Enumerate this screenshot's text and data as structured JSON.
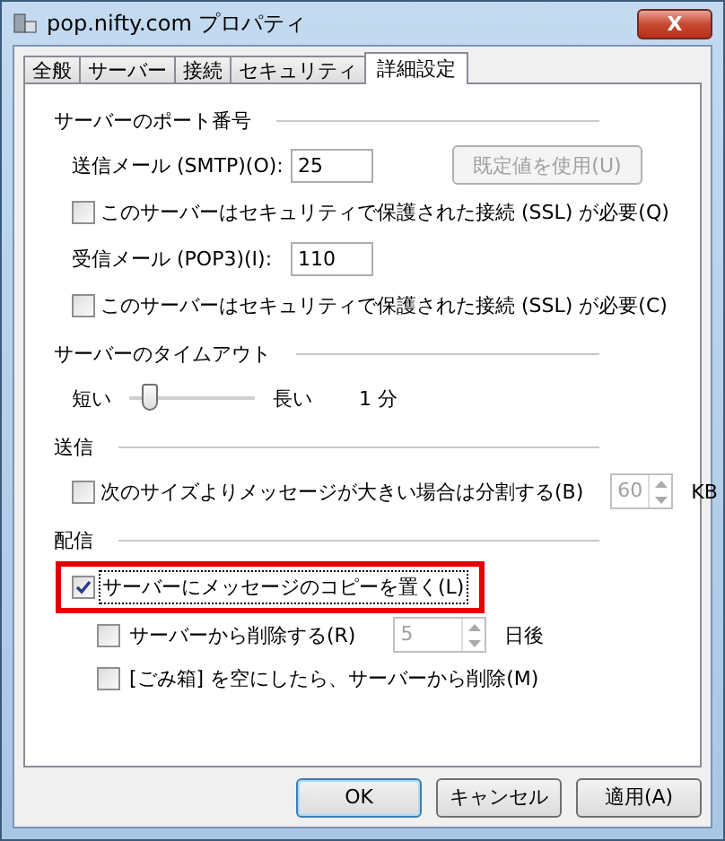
{
  "window": {
    "title": "pop.nifty.com プロパティ",
    "close": "X"
  },
  "tabs": [
    {
      "label": "全般",
      "selected": false
    },
    {
      "label": "サーバー",
      "selected": false
    },
    {
      "label": "接続",
      "selected": false
    },
    {
      "label": "セキュリティ",
      "selected": false
    },
    {
      "label": "詳細設定",
      "selected": true
    }
  ],
  "sections": [
    {
      "title": "サーバーのポート番号",
      "rows": [
        {
          "kind": "port",
          "label": "送信メール (SMTP)(O):",
          "value": "25",
          "button": {
            "label": "既定値を使用(U)",
            "disabled": true
          }
        },
        {
          "kind": "checkbox",
          "label": "このサーバーはセキュリティで保護された接続 (SSL) が必要(Q)",
          "checked": false
        },
        {
          "kind": "port",
          "label": "受信メール (POP3)(I):",
          "value": "110"
        },
        {
          "kind": "checkbox",
          "label": "このサーバーはセキュリティで保護された接続 (SSL) が必要(C)",
          "checked": false
        }
      ]
    },
    {
      "title": "サーバーのタイムアウト",
      "rows": [
        {
          "kind": "slider",
          "min_label": "短い",
          "max_label": "長い",
          "level": 0.15,
          "reading": "1 分"
        }
      ]
    },
    {
      "title": "送信",
      "rows": [
        {
          "kind": "checkbox",
          "label": "次のサイズよりメッセージが大きい場合は分割する(B)",
          "checked": false,
          "spin": {
            "value": "60",
            "disabled": true,
            "unit": "KB"
          }
        }
      ]
    },
    {
      "title": "配信",
      "rows": [
        {
          "kind": "checkbox",
          "label": "サーバーにメッセージのコピーを置く(L)",
          "checked": true,
          "highlighted": true,
          "children": [
            {
              "kind": "checkbox",
              "label": "サーバーから削除する(R)",
              "checked": false,
              "spin": {
                "value": "5",
                "disabled": true,
                "unit": "日後"
              }
            },
            {
              "kind": "checkbox",
              "label": "[ごみ箱] を空にしたら、サーバーから削除(M)",
              "checked": false
            }
          ]
        }
      ]
    }
  ],
  "buttons": [
    {
      "label": "OK",
      "default": true
    },
    {
      "label": "キャンセル",
      "default": false
    },
    {
      "label": "適用(A)",
      "default": false
    }
  ]
}
